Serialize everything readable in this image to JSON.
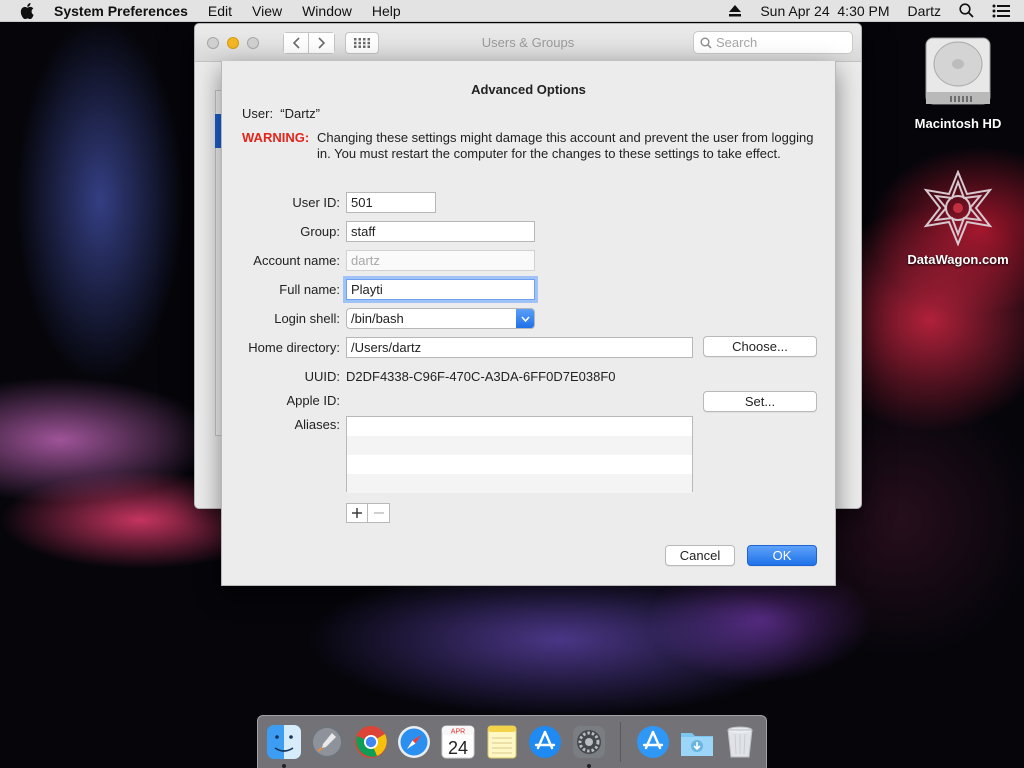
{
  "menubar": {
    "app_name": "System Preferences",
    "menus": [
      "Edit",
      "View",
      "Window",
      "Help"
    ],
    "clock": "Sun Apr 24  4:30 PM",
    "user": "Dartz"
  },
  "desktop": {
    "icons": [
      {
        "label": "Macintosh HD",
        "icon": "hard-drive-icon"
      },
      {
        "label": "DataWagon.com",
        "icon": "star-logo-icon"
      }
    ]
  },
  "window": {
    "title": "Users & Groups",
    "search_placeholder": "Search"
  },
  "sheet": {
    "title": "Advanced Options",
    "user_line": "User:  “Dartz”",
    "warning_label": "WARNING:",
    "warning_text": "Changing these settings might damage this account and prevent the user from logging in. You must restart the computer for the changes to these settings to take effect.",
    "fields": {
      "user_id": {
        "label": "User ID:",
        "value": "501"
      },
      "group": {
        "label": "Group:",
        "value": "staff"
      },
      "account_name": {
        "label": "Account name:",
        "value": "dartz"
      },
      "full_name": {
        "label": "Full name:",
        "value": "Playti"
      },
      "login_shell": {
        "label": "Login shell:",
        "value": "/bin/bash"
      },
      "home_directory": {
        "label": "Home directory:",
        "value": "/Users/dartz"
      },
      "uuid": {
        "label": "UUID:",
        "value": "D2DF4338-C96F-470C-A3DA-6FF0D7E038F0"
      },
      "apple_id": {
        "label": "Apple ID:",
        "value": ""
      },
      "aliases": {
        "label": "Aliases:"
      }
    },
    "buttons": {
      "choose": "Choose...",
      "set": "Set...",
      "cancel": "Cancel",
      "ok": "OK"
    }
  },
  "dock": {
    "items": [
      {
        "name": "Finder",
        "icon": "finder-icon",
        "running": true
      },
      {
        "name": "Launchpad",
        "icon": "launchpad-icon",
        "running": false
      },
      {
        "name": "Chrome",
        "icon": "chrome-icon",
        "running": false
      },
      {
        "name": "Safari",
        "icon": "safari-icon",
        "running": false
      },
      {
        "name": "Calendar",
        "icon": "calendar-icon",
        "running": false,
        "month": "APR",
        "day": "24"
      },
      {
        "name": "Notes",
        "icon": "notes-icon",
        "running": false
      },
      {
        "name": "App Store",
        "icon": "app-store-icon",
        "running": false
      },
      {
        "name": "System Preferences",
        "icon": "system-preferences-icon",
        "running": true
      },
      {
        "name": "App Store Downloads",
        "icon": "app-store-icon",
        "running": false
      },
      {
        "name": "Downloads",
        "icon": "downloads-folder-icon",
        "running": false
      },
      {
        "name": "Trash",
        "icon": "trash-icon",
        "running": false
      }
    ]
  },
  "colors": {
    "accent": "#1f72ea",
    "warning": "#e4241b",
    "menubar_bg": "#ececec"
  }
}
